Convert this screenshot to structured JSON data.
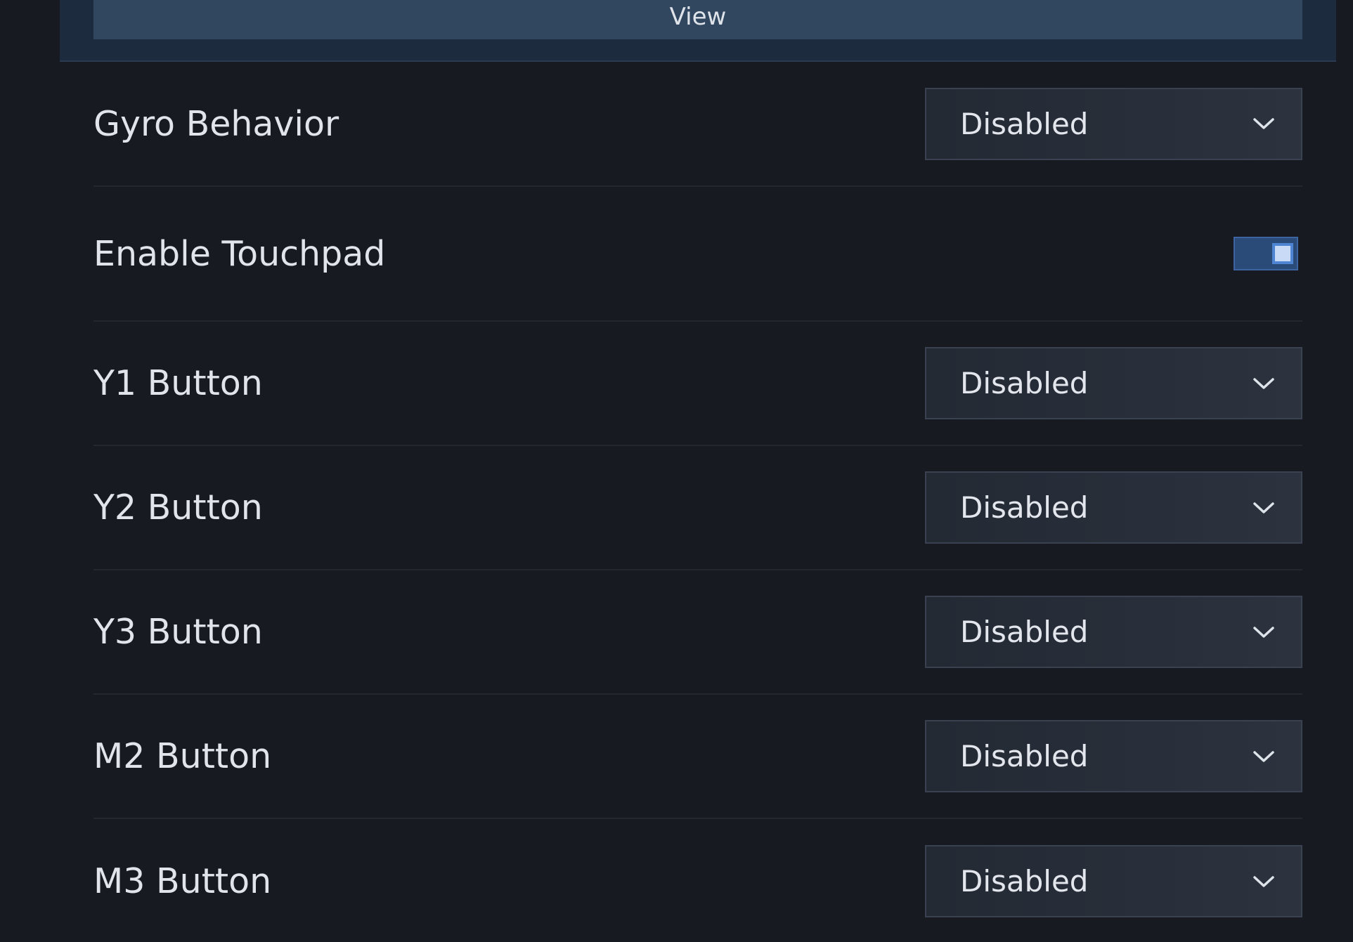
{
  "top": {
    "view_label": "View"
  },
  "settings": {
    "gyro_behavior": {
      "label": "Gyro Behavior",
      "value": "Disabled"
    },
    "enable_touchpad": {
      "label": "Enable Touchpad",
      "checked": true
    },
    "y1_button": {
      "label": "Y1 Button",
      "value": "Disabled"
    },
    "y2_button": {
      "label": "Y2 Button",
      "value": "Disabled"
    },
    "y3_button": {
      "label": "Y3 Button",
      "value": "Disabled"
    },
    "m2_button": {
      "label": "M2 Button",
      "value": "Disabled"
    },
    "m3_button": {
      "label": "M3 Button",
      "value": "Disabled"
    }
  },
  "icons": {
    "dropdown": "chevron-down-icon"
  },
  "colors": {
    "background": "#171a20",
    "accent": "#4f84d2",
    "dropdown_bg": "#2a303b"
  }
}
